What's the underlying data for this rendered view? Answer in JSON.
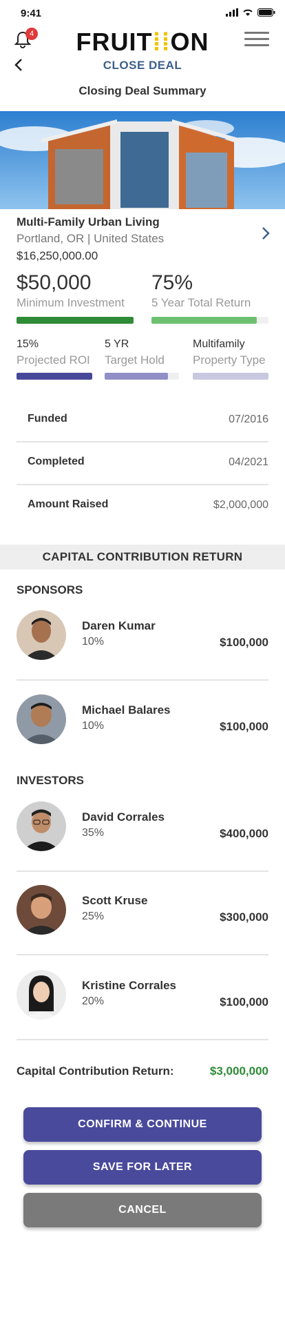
{
  "status_bar": {
    "time": "9:41"
  },
  "header": {
    "logo_left": "FRUIT",
    "logo_mid": "⁞⁞",
    "logo_right": "ON",
    "subtitle": "CLOSE DEAL",
    "page_title": "Closing Deal Summary",
    "notification_count": "4"
  },
  "property": {
    "name": "Multi-Family Urban Living",
    "location": "Portland, OR | United States",
    "price": "$16,250,000.00"
  },
  "stats": {
    "min_investment": {
      "value": "$50,000",
      "label": "Minimum Investment",
      "progress": 1.0,
      "color": "#2e8b36"
    },
    "total_return": {
      "value": "75%",
      "label": "5 Year Total Return",
      "progress": 0.9,
      "color": "#6cc070"
    }
  },
  "metrics": [
    {
      "value": "15%",
      "label": "Projected ROI",
      "progress": 1.0,
      "color": "#48489a"
    },
    {
      "value": "5 YR",
      "label": "Target Hold",
      "progress": 0.85,
      "color": "#9090c6"
    },
    {
      "value": "Multifamily",
      "label": "Property Type",
      "progress": 1.0,
      "color": "#c8c8e0"
    }
  ],
  "details": [
    {
      "label": "Funded",
      "value": "07/2016"
    },
    {
      "label": "Completed",
      "value": "04/2021"
    },
    {
      "label": "Amount Raised",
      "value": "$2,000,000"
    }
  ],
  "section_banner": "CAPITAL CONTRIBUTION RETURN",
  "sponsors_title": "SPONSORS",
  "sponsors": [
    {
      "name": "Daren Kumar",
      "percent": "10%",
      "amount": "$100,000"
    },
    {
      "name": "Michael Balares",
      "percent": "10%",
      "amount": "$100,000"
    }
  ],
  "investors_title": "INVESTORS",
  "investors": [
    {
      "name": "David Corrales",
      "percent": "35%",
      "amount": "$400,000"
    },
    {
      "name": "Scott Kruse",
      "percent": "25%",
      "amount": "$300,000"
    },
    {
      "name": "Kristine Corrales",
      "percent": "20%",
      "amount": "$100,000"
    }
  ],
  "total": {
    "label": "Capital Contribution Return:",
    "value": "$3,000,000"
  },
  "buttons": {
    "confirm": "CONFIRM & CONTINUE",
    "save": "SAVE FOR LATER",
    "cancel": "CANCEL"
  },
  "colors": {
    "primary_button": "#4a4a9c",
    "cancel_button": "#7a7a7a",
    "accent_blue": "#3d5f8c",
    "total_green": "#2e8b36"
  }
}
